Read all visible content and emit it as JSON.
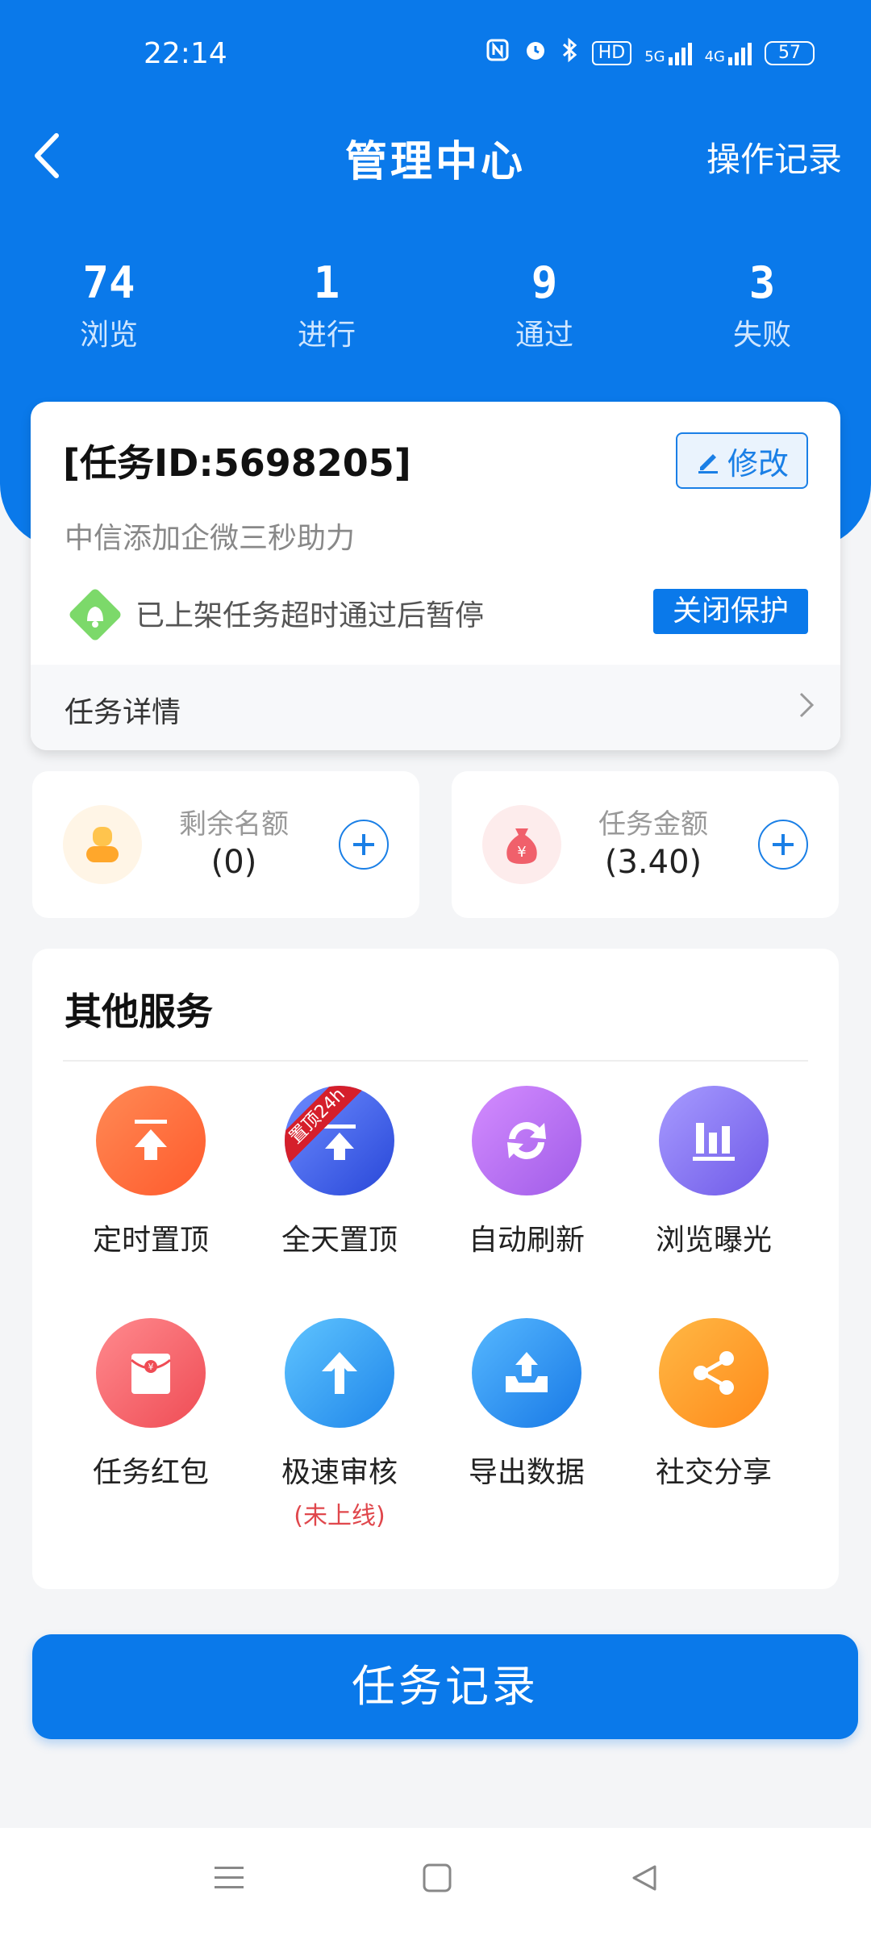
{
  "status_bar": {
    "time": "22:14",
    "icons": [
      "nfc-icon",
      "alarm-icon",
      "bluetooth-icon",
      "hd-icon",
      "signal-5g-icon",
      "signal-4g-icon",
      "battery-icon"
    ],
    "hd_label": "HD",
    "net1": "5G",
    "net2": "4G",
    "battery": "57"
  },
  "header": {
    "title": "管理中心",
    "right_action": "操作记录"
  },
  "stats": [
    {
      "value": "74",
      "label": "浏览"
    },
    {
      "value": "1",
      "label": "进行"
    },
    {
      "value": "9",
      "label": "通过"
    },
    {
      "value": "3",
      "label": "失败"
    }
  ],
  "task": {
    "id_text": "[任务ID:5698205]",
    "edit_label": "修改",
    "description": "中信添加企微三秒助力",
    "notice": "已上架任务超时通过后暂停",
    "close_protect": "关闭保护",
    "detail_label": "任务详情"
  },
  "quota": {
    "label": "剩余名额",
    "value": "(0)"
  },
  "amount": {
    "label": "任务金额",
    "value": "(3.40)"
  },
  "services": {
    "title": "其他服务",
    "items": [
      {
        "label": "定时置顶",
        "icon": "pin-top-icon",
        "color": "#ff6a3d"
      },
      {
        "label": "全天置顶",
        "icon": "pin-top-24h-icon",
        "color": "#3e5fe0",
        "ribbon": "置顶24h"
      },
      {
        "label": "自动刷新",
        "icon": "refresh-icon",
        "color": "#b56cf0"
      },
      {
        "label": "浏览曝光",
        "icon": "bar-chart-icon",
        "color": "#7e6ff2"
      },
      {
        "label": "任务红包",
        "icon": "red-envelope-icon",
        "color": "#f25d63"
      },
      {
        "label": "极速审核",
        "icon": "arrow-up-icon",
        "color": "#2f9cf2",
        "sub": "(未上线)"
      },
      {
        "label": "导出数据",
        "icon": "export-icon",
        "color": "#2d8fee"
      },
      {
        "label": "社交分享",
        "icon": "share-icon",
        "color": "#ff9b22"
      }
    ]
  },
  "record_button": "任务记录",
  "colors": {
    "primary": "#0a79ea",
    "warning": "#e0474c"
  }
}
